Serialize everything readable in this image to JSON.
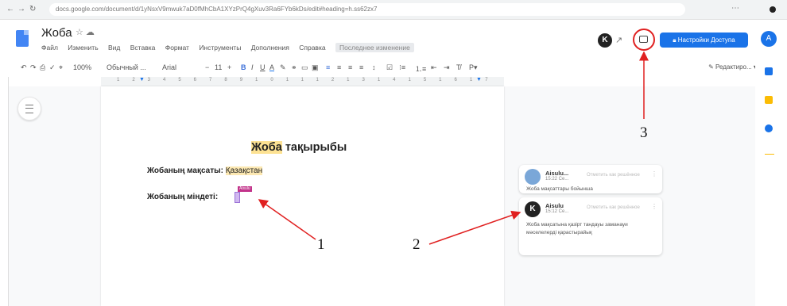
{
  "browser": {
    "url": "docs.google.com/document/d/1yNsxV9mwuk7aD0fMhCbA1XYzPrQ4gXuv3Ra6FYb6kDs/edit#heading=h.ss62zx7"
  },
  "doc": {
    "title": "Жоба",
    "menu": [
      "Файл",
      "Изменить",
      "Вид",
      "Вставка",
      "Формат",
      "Инструменты",
      "Дополнения",
      "Справка"
    ],
    "last_edit": "Последнее изменение",
    "share_label": "Настройки Доступа",
    "user_initial": "A",
    "collab_initial": "K",
    "toolbar": {
      "zoom": "100%",
      "style": "Обычный ...",
      "font": "Arial",
      "size": "11",
      "editing": "Редактиро..."
    }
  },
  "page": {
    "heading_highlight": "Жоба",
    "heading_rest": "тақырыбы",
    "goal_label": "Жобаның мақсаты:",
    "goal_value": "Қазақстан",
    "task_label": "Жобаның міндеті:",
    "cursor_name": "Aisulu"
  },
  "comments": [
    {
      "author": "Aisulu...",
      "time": "15:22 Се...",
      "action": "Отметить как решённое",
      "text": "Жоба мақсаттары бойынша"
    },
    {
      "author": "Aisulu",
      "time": "15:12 Се...",
      "action": "Отметить как решённое",
      "text": "Жоба мақсатына қазірт тандауы заманауи мәселелерді қарастырайық"
    }
  ],
  "annotations": [
    "1",
    "2",
    "3"
  ],
  "colors": {
    "accent": "#1a73e8",
    "annotation": "#e02020",
    "highlight": "#fde293"
  }
}
